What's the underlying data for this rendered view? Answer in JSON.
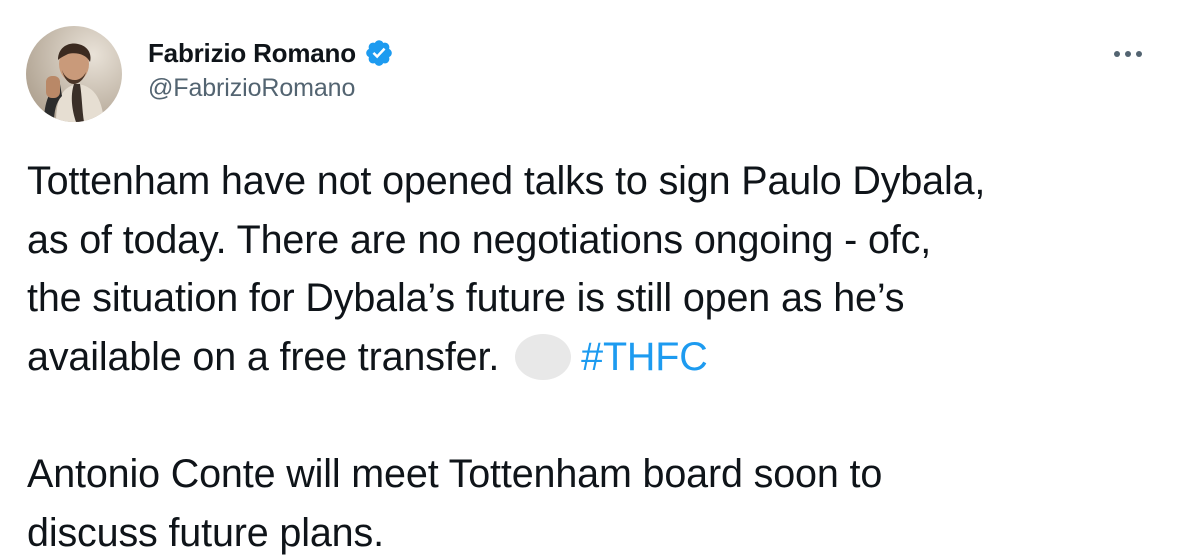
{
  "author": {
    "display_name": "Fabrizio Romano",
    "handle": "@FabrizioRomano",
    "verified": true,
    "avatar_icon": "profile-photo",
    "verified_icon": "verified-badge-icon",
    "verified_color": "#1d9bf0"
  },
  "more_icon": "more-options-icon",
  "tweet": {
    "paragraph1": {
      "line1": "Tottenham have not opened talks to sign Paulo Dybala,",
      "line2": "as of today. There are no negotiations ongoing - ofc,",
      "line3": "the situation for Dybala’s future is still open as he’s",
      "line4_text": "available on a free transfer.",
      "emoji_icon": "emoji-placeholder",
      "hashtag": "#THFC"
    },
    "paragraph2": {
      "line1": "Antonio Conte will meet Tottenham board soon to",
      "line2": "discuss future plans."
    }
  },
  "colors": {
    "text": "#0f1419",
    "secondary": "#536471",
    "link": "#1d9bf0"
  }
}
